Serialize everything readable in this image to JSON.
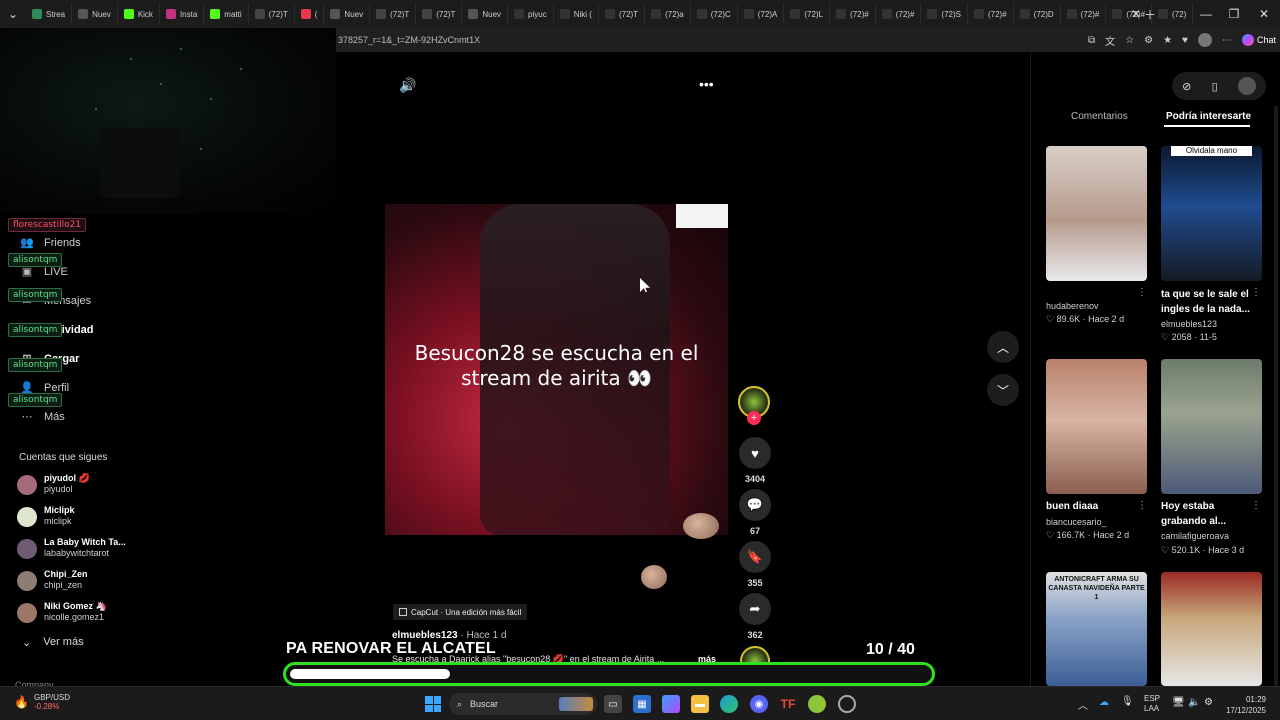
{
  "browser": {
    "tabs": [
      {
        "label": "Strea",
        "color": "#2e8b57"
      },
      {
        "label": "Nuev",
        "color": "#555555"
      },
      {
        "label": "Kick",
        "color": "#53fc18"
      },
      {
        "label": "Insta",
        "color": "#c13584"
      },
      {
        "label": "matti",
        "color": "#53fc18"
      },
      {
        "label": "(72)T",
        "color": "#444444"
      },
      {
        "label": "(",
        "color": "#e8364b"
      },
      {
        "label": "Nuev",
        "color": "#555555"
      },
      {
        "label": "(72)T",
        "color": "#444444"
      },
      {
        "label": "(72)T",
        "color": "#444444"
      },
      {
        "label": "Nuev",
        "color": "#555555"
      },
      {
        "label": "piyuc",
        "color": "#333333"
      },
      {
        "label": "Niki (",
        "color": "#333333"
      },
      {
        "label": "(72)T",
        "color": "#333333"
      },
      {
        "label": "(72)a",
        "color": "#333333"
      },
      {
        "label": "(72)C",
        "color": "#333333"
      },
      {
        "label": "(72)A",
        "color": "#333333"
      },
      {
        "label": "(72)L",
        "color": "#333333"
      },
      {
        "label": "(72)#",
        "color": "#333333"
      },
      {
        "label": "(72)#",
        "color": "#333333"
      },
      {
        "label": "(72)S",
        "color": "#333333"
      },
      {
        "label": "(72)#",
        "color": "#333333"
      },
      {
        "label": "(72)D",
        "color": "#333333"
      },
      {
        "label": "(72)#",
        "color": "#333333"
      },
      {
        "label": "(72)#",
        "color": "#333333"
      },
      {
        "label": "(72)",
        "color": "#333333"
      }
    ],
    "url": "378257_r=1&_t=ZM-92HZvCnmt1X",
    "chat_label": "Chat"
  },
  "sidebar": {
    "nav": [
      {
        "label": "Friends",
        "icon": "friends-icon"
      },
      {
        "label": "LIVE",
        "icon": "live-icon"
      },
      {
        "label": "Mensajes",
        "icon": "messages-icon"
      },
      {
        "label": "Actividad",
        "icon": "activity-icon"
      },
      {
        "label": "Cargar",
        "icon": "upload-icon"
      },
      {
        "label": "Perfil",
        "icon": "profile-icon"
      },
      {
        "label": "Más",
        "icon": "more-icon"
      }
    ],
    "chat_overlay": [
      {
        "name": "florescastillo21",
        "style": "red"
      },
      {
        "name": "alisontqm",
        "style": "green"
      },
      {
        "name": "alisontqm",
        "style": "green"
      },
      {
        "name": "alisontqm",
        "style": "green"
      },
      {
        "name": "alisontqm",
        "style": "green"
      },
      {
        "name": "alisontqm",
        "style": "green"
      }
    ],
    "following_title": "Cuentas que sigues",
    "following": [
      {
        "name": "piyudol 💋",
        "handle": "piyudol",
        "color": "#a46b7a"
      },
      {
        "name": "Miclipk",
        "handle": "miclipk",
        "color": "#dfe6cf"
      },
      {
        "name": "La Baby Witch Ta...",
        "handle": "lababywitchtarot",
        "color": "#6f5c74"
      },
      {
        "name": "Chipi_Zen",
        "handle": "chipi_zen",
        "color": "#8e7d72"
      },
      {
        "name": "Niki Gomez 🦄",
        "handle": "nicolle.gomez1",
        "color": "#9c7767"
      }
    ],
    "see_more": "Ver más",
    "company": "Company"
  },
  "video": {
    "caption": "Besucon28 se escucha en el stream de airita 👀",
    "capcut_label": "CapCut · Una edición más fácil",
    "author": "elmuebles123",
    "age": "· Hace 1 d",
    "description": "Se escucha a Daarick alias \"besucon28 💋\" en el stream de Airita ...",
    "more_label": "más",
    "likes": "3404",
    "comments": "67",
    "saves": "355",
    "shares": "362"
  },
  "overlay": {
    "title": "PA RENOVAR EL ALCATEL",
    "counter_current": "10",
    "counter_total": "/ 40",
    "progress": 0.25
  },
  "right_panel": {
    "tabs": [
      "Comentarios",
      "Podría interesarte"
    ],
    "cards": [
      {
        "title": "",
        "user": "hudaberenov",
        "stats": "♡ 89.6K · Hace 2 d",
        "bg": "linear-gradient(180deg,#d9cfc7,#b59a8c 55%,#e8e8ea)"
      },
      {
        "title": "ta que se le sale el ingles de la nada...",
        "user": "elmuebles123",
        "stats": "♡ 2058 · 11-5",
        "bg": "linear-gradient(180deg,#0c1830,#1f4c8f 45%,#151a24)"
      },
      {
        "title": "buen diaaa",
        "user": "biancucesario_",
        "stats": "♡ 166.7K · Hace 2 d",
        "bg": "linear-gradient(180deg,#b8816b,#d8b4a4 45%,#8a5f52)"
      },
      {
        "title": "Hoy estaba grabando al...",
        "user": "camilafigueroava",
        "stats": "♡ 520.1K · Hace 3 d",
        "bg": "linear-gradient(180deg,#6d7d6b,#9aa38e 40%,#4d5a78)"
      },
      {
        "title": "",
        "user": "",
        "stats": "",
        "bg": "linear-gradient(180deg,#e0e0e0,#8aa3c7 40%,#3d5f97)"
      },
      {
        "title": "",
        "user": "",
        "stats": "",
        "bg": "linear-gradient(180deg,#9b2a24,#c7a77a 40%,#e6e6e6)"
      }
    ],
    "card_overlay_texts": [
      "ANTONICRAFT ARMA SU CANASTA NAVIDEÑA PARTE 1",
      "Olvidala mano"
    ]
  },
  "taskbar": {
    "ticker_pair": "GBP/USD",
    "ticker_change": "-0.28%",
    "search_placeholder": "Buscar",
    "lang": "ESP",
    "lang2": "LAA",
    "time": "01:29",
    "date": "17/12/2025"
  }
}
